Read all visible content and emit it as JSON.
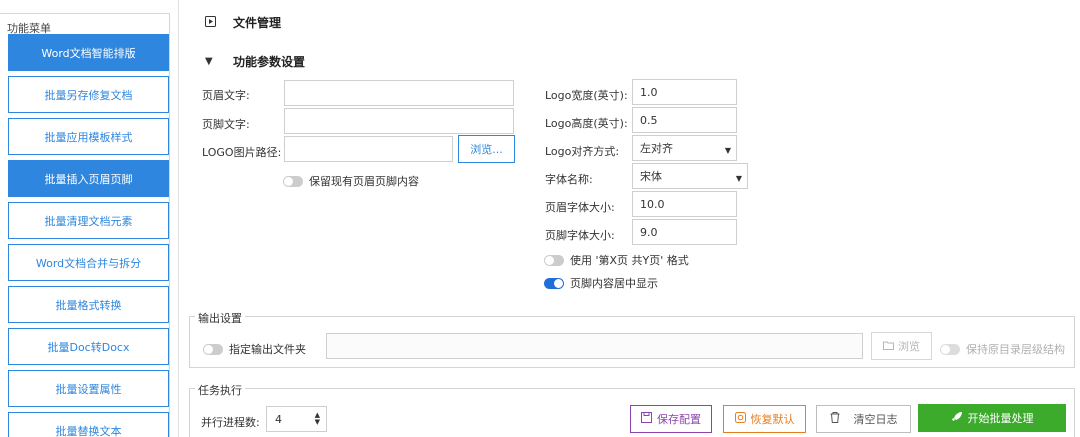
{
  "menu": {
    "title": "功能菜单",
    "items": [
      {
        "label": "Word文档智能排版",
        "active": true
      },
      {
        "label": "批量另存修复文档",
        "active": false
      },
      {
        "label": "批量应用模板样式",
        "active": false
      },
      {
        "label": "批量插入页眉页脚",
        "active": true
      },
      {
        "label": "批量清理文档元素",
        "active": false
      },
      {
        "label": "Word文档合并与拆分",
        "active": false
      },
      {
        "label": "批量格式转换",
        "active": false
      },
      {
        "label": "批量Doc转Docx",
        "active": false
      },
      {
        "label": "批量设置属性",
        "active": false
      },
      {
        "label": "批量替换文本",
        "active": false
      }
    ]
  },
  "file_section": {
    "title": "文件管理",
    "icon": "play-square-icon"
  },
  "params_section": {
    "title": "功能参数设置",
    "icon": "triangle-down-icon",
    "header_text_label": "页眉文字:",
    "header_text_value": "",
    "footer_text_label": "页脚文字:",
    "footer_text_value": "",
    "logo_path_label": "LOGO图片路径:",
    "logo_path_value": "",
    "browse_label": "浏览...",
    "keep_existing_label": "保留现有页眉页脚内容",
    "logo_width_label": "Logo宽度(英寸):",
    "logo_width_value": "1.0",
    "logo_height_label": "Logo高度(英寸):",
    "logo_height_value": "0.5",
    "logo_align_label": "Logo对齐方式:",
    "logo_align_value": "左对齐",
    "font_name_label": "字体名称:",
    "font_name_value": "宋体",
    "header_size_label": "页眉字体大小:",
    "header_size_value": "10.0",
    "footer_size_label": "页脚字体大小:",
    "footer_size_value": "9.0",
    "page_format_label": "使用 '第X页 共Y页' 格式",
    "footer_center_label": "页脚内容居中显示"
  },
  "output": {
    "title": "输出设置",
    "specify_folder_label": "指定输出文件夹",
    "folder_value": "",
    "browse_label": "浏览",
    "keep_structure_label": "保持原目录层级结构"
  },
  "task": {
    "title": "任务执行",
    "threads_label": "并行进程数:",
    "threads_value": "4",
    "save_label": "保存配置",
    "restore_label": "恢复默认",
    "clear_label": "清空日志",
    "start_label": "开始批量处理"
  },
  "colors": {
    "accent": "#2e86de",
    "save": "#8e44ad",
    "restore": "#e67e22",
    "start": "#3cab2c"
  }
}
